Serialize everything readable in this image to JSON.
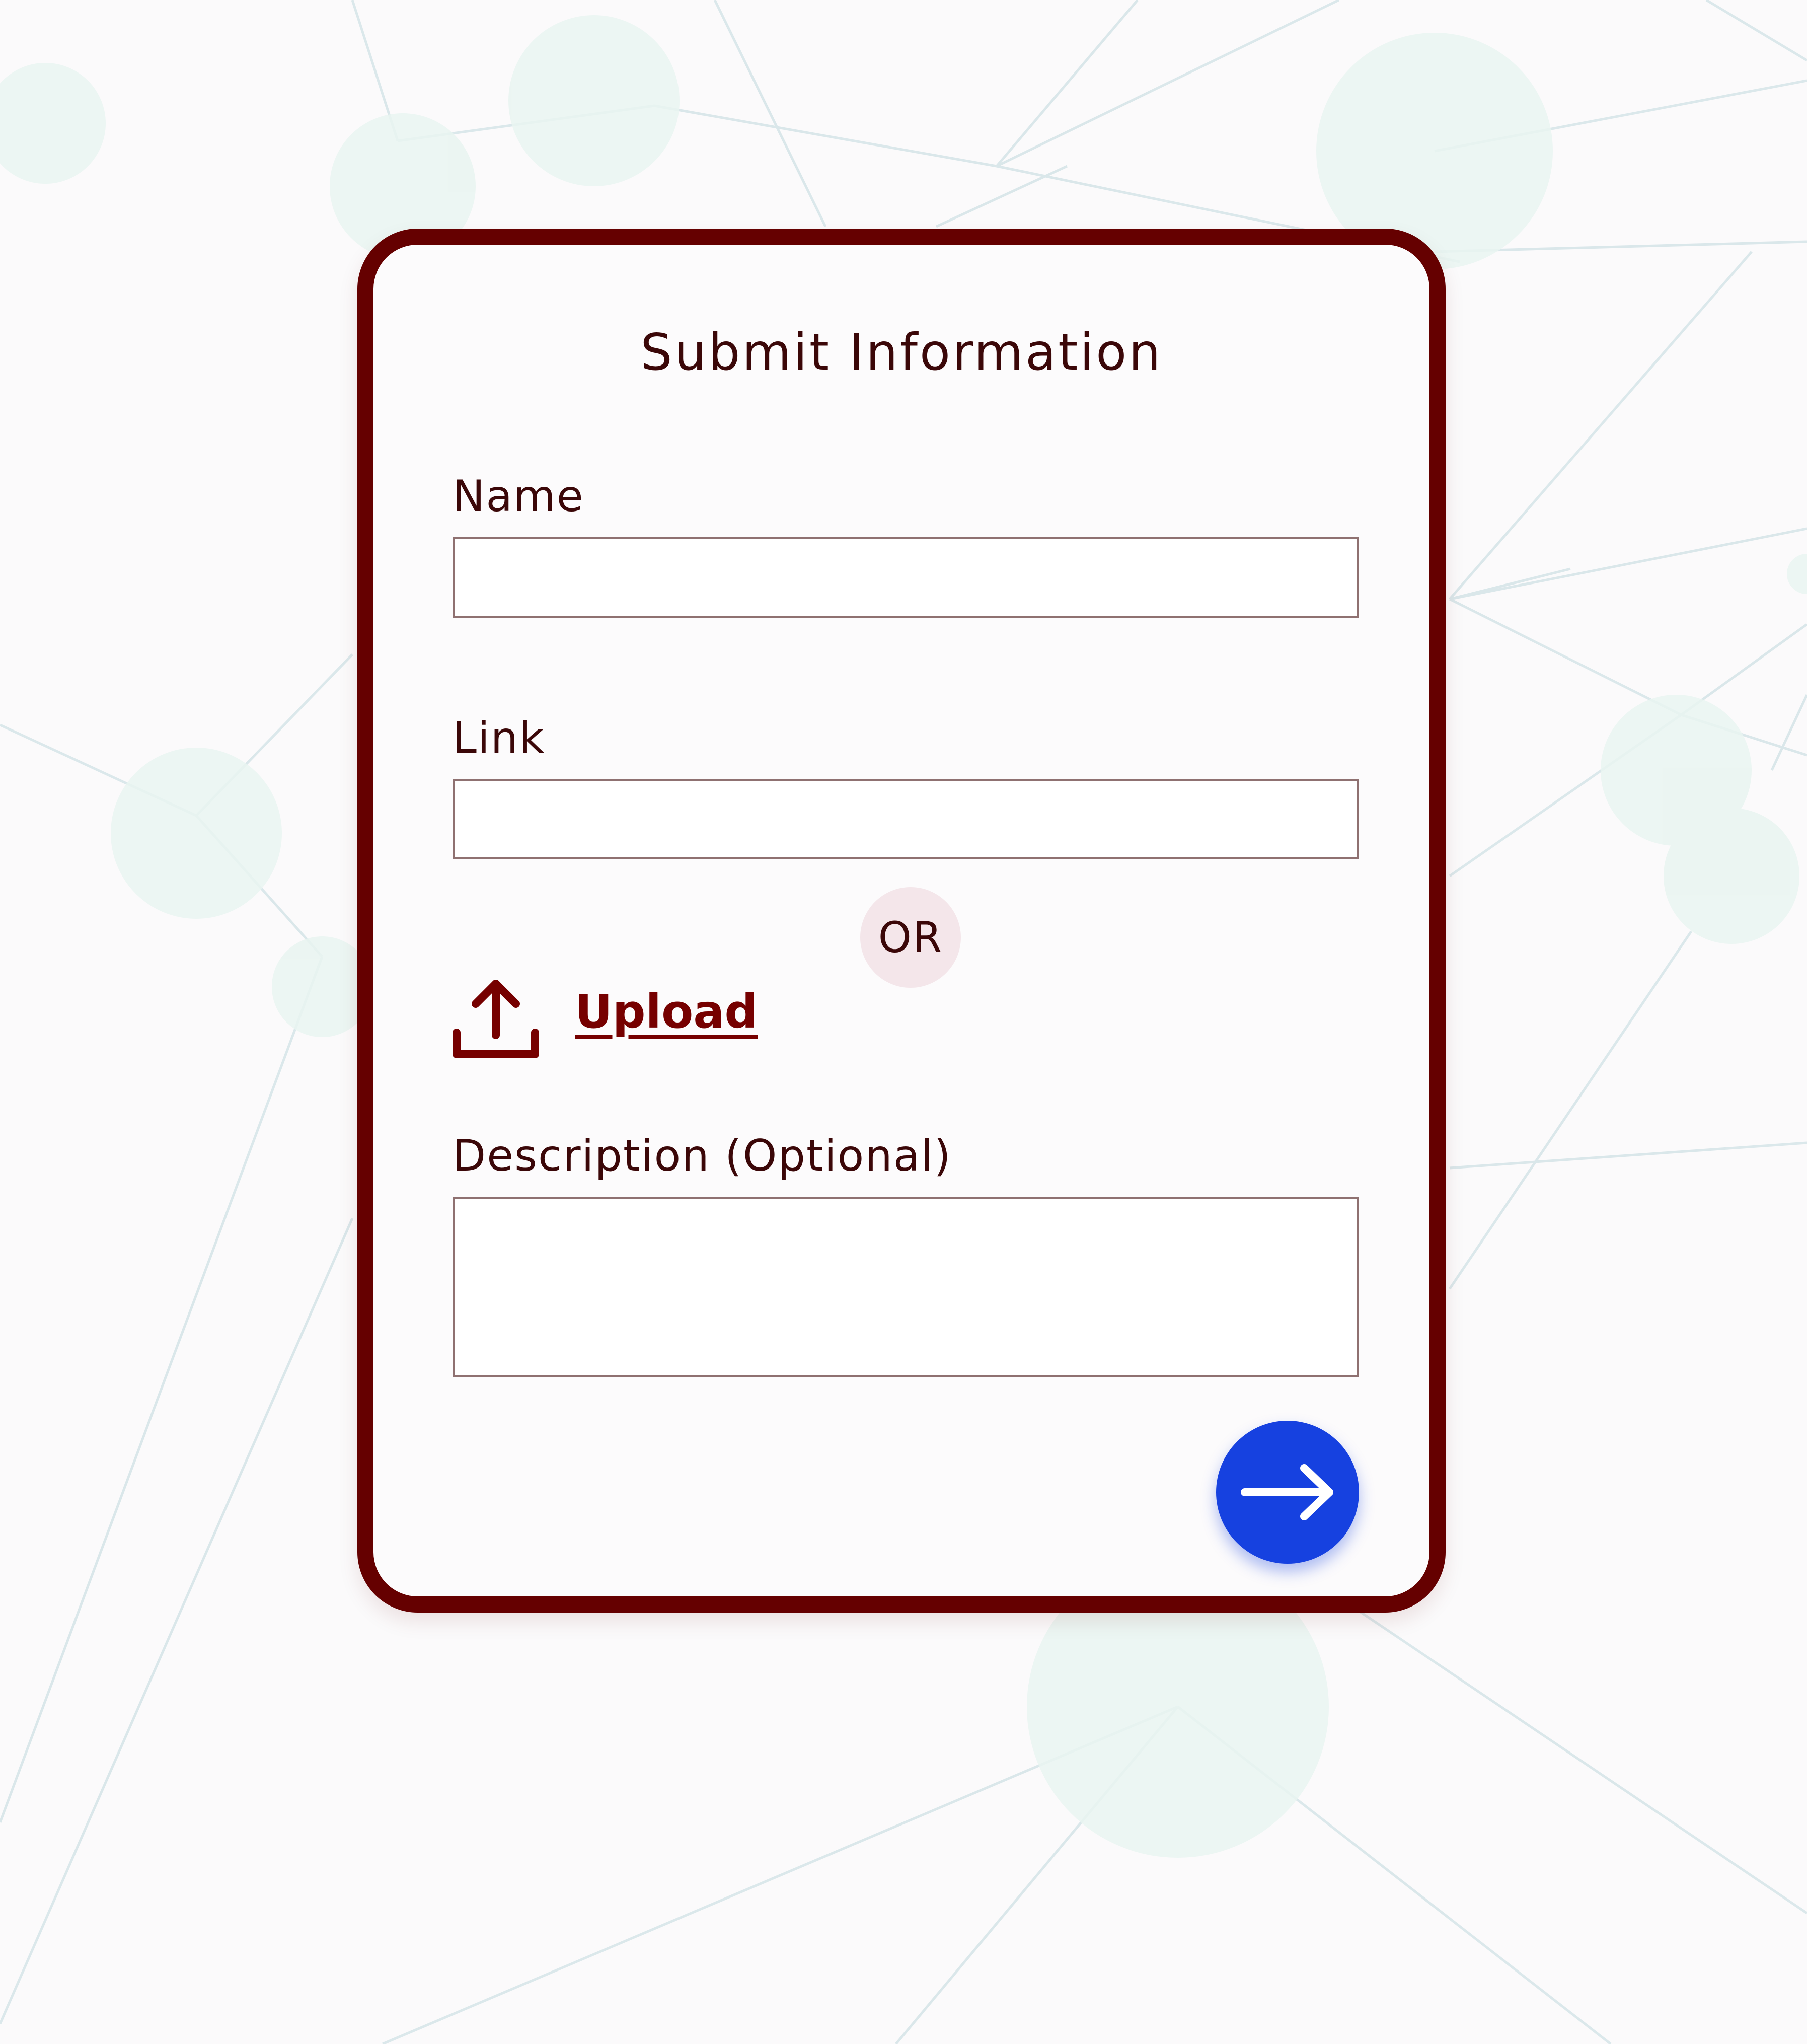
{
  "form": {
    "title": "Submit Information",
    "name_label": "Name",
    "name_value": "",
    "link_label": "Link",
    "link_value": "",
    "or_text": "OR",
    "upload_label": "Upload",
    "description_label": "Description",
    "description_optional": "(Optional)",
    "description_value": "",
    "submit_icon": "arrow-right-icon",
    "upload_icon": "upload-icon"
  },
  "colors": {
    "card_border": "#650000",
    "text": "#3b0708",
    "link": "#760000",
    "or_badge": "#f4e6ea",
    "submit_button": "#1641e0",
    "background_nodes": "#eaf6f2"
  }
}
